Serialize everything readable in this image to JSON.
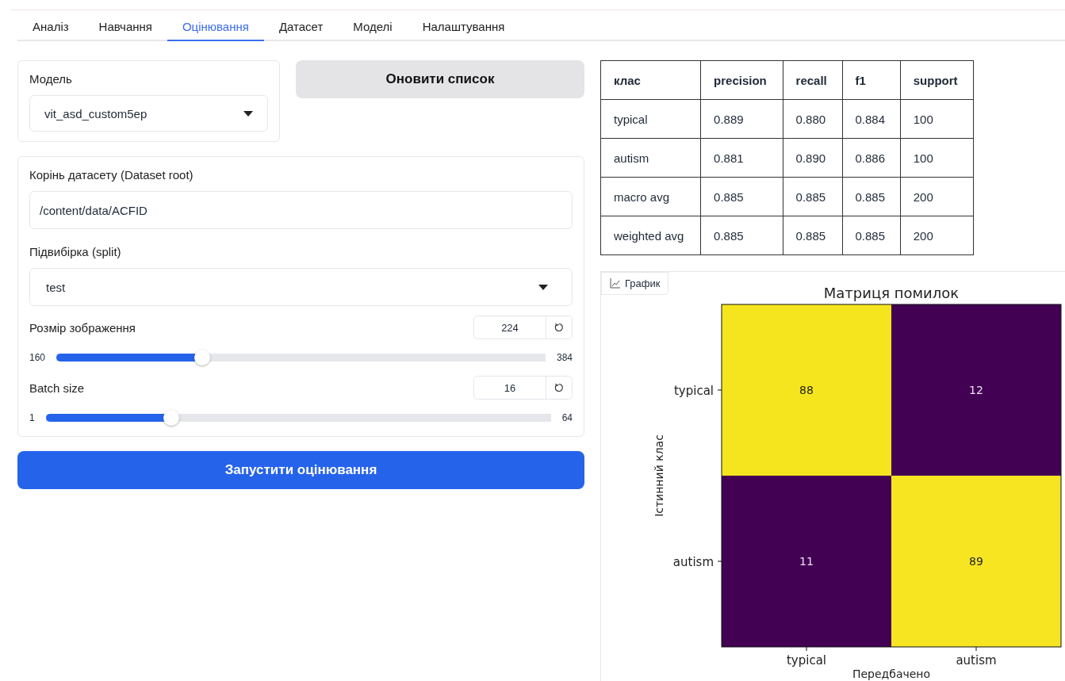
{
  "tabs": [
    {
      "label": "Аналіз",
      "selected": false
    },
    {
      "label": "Навчання",
      "selected": false
    },
    {
      "label": "Оцінювання",
      "selected": true
    },
    {
      "label": "Датасет",
      "selected": false
    },
    {
      "label": "Моделі",
      "selected": false
    },
    {
      "label": "Налаштування",
      "selected": false
    }
  ],
  "model": {
    "label": "Модель",
    "value": "vit_asd_custom5ep"
  },
  "refresh_button": "Оновити список",
  "dataset_root": {
    "label": "Корінь датасету (Dataset root)",
    "value": "/content/data/ACFID"
  },
  "split": {
    "label": "Підвибірка (split)",
    "value": "test"
  },
  "sliders": [
    {
      "label": "Розмір зображення",
      "value": "224",
      "min": "160",
      "max": "384",
      "level": 0.29
    },
    {
      "label": "Batch size",
      "value": "16",
      "min": "1",
      "max": "64",
      "level": 0.24
    }
  ],
  "run_button": "Запустити оцінювання",
  "metrics_table": {
    "columns": [
      "клас",
      "precision",
      "recall",
      "f1",
      "support"
    ],
    "rows": [
      [
        "typical",
        "0.889",
        "0.880",
        "0.884",
        "100"
      ],
      [
        "autism",
        "0.881",
        "0.890",
        "0.886",
        "100"
      ],
      [
        "macro avg",
        "0.885",
        "0.885",
        "0.885",
        "200"
      ],
      [
        "weighted avg",
        "0.885",
        "0.885",
        "0.885",
        "200"
      ]
    ]
  },
  "plot": {
    "badge": "График",
    "title": "Матриця помилок",
    "xlabel": "Передбачено",
    "ylabel": "Істинний клас",
    "x_classes": [
      "typical",
      "autism"
    ],
    "y_classes": [
      "typical",
      "autism"
    ],
    "cells": [
      [
        {
          "value": "88",
          "color": "#f5e51e"
        },
        {
          "value": "12",
          "color": "#430153"
        }
      ],
      [
        {
          "value": "11",
          "color": "#430153"
        },
        {
          "value": "89",
          "color": "#f7e522"
        }
      ]
    ]
  }
}
